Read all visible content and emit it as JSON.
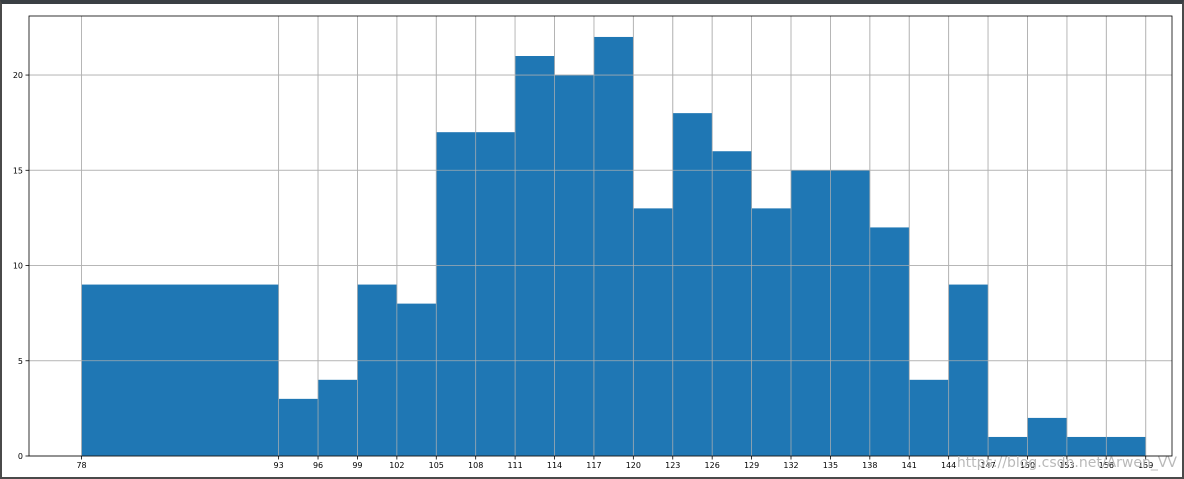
{
  "chart_data": {
    "type": "bar",
    "title": "",
    "xlabel": "",
    "ylabel": "",
    "bins": [
      78,
      93,
      96,
      99,
      102,
      105,
      108,
      111,
      114,
      117,
      120,
      123,
      126,
      129,
      132,
      135,
      138,
      141,
      144,
      147,
      150,
      153,
      156,
      159
    ],
    "x_tick_labels": [
      "78",
      "93",
      "96",
      "99",
      "102",
      "105",
      "108",
      "111",
      "114",
      "117",
      "120",
      "123",
      "126",
      "129",
      "132",
      "135",
      "138",
      "141",
      "144",
      "147",
      "150",
      "153",
      "156",
      "159"
    ],
    "counts": [
      9,
      3,
      4,
      9,
      8,
      17,
      17,
      21,
      20,
      22,
      13,
      18,
      16,
      13,
      15,
      15,
      12,
      4,
      9,
      1,
      2,
      1,
      1
    ],
    "y_ticks": [
      0,
      5,
      10,
      15,
      20
    ],
    "y_tick_labels": [
      "0",
      "5",
      "10",
      "15",
      "20"
    ],
    "xlim": [
      74,
      161
    ],
    "ylim": [
      0,
      23.1
    ],
    "grid": true,
    "bar_color": "#1f77b4",
    "grid_color": "#b0b0b0"
  },
  "watermark": "https://blog.csdn.net/Arwen_VV"
}
